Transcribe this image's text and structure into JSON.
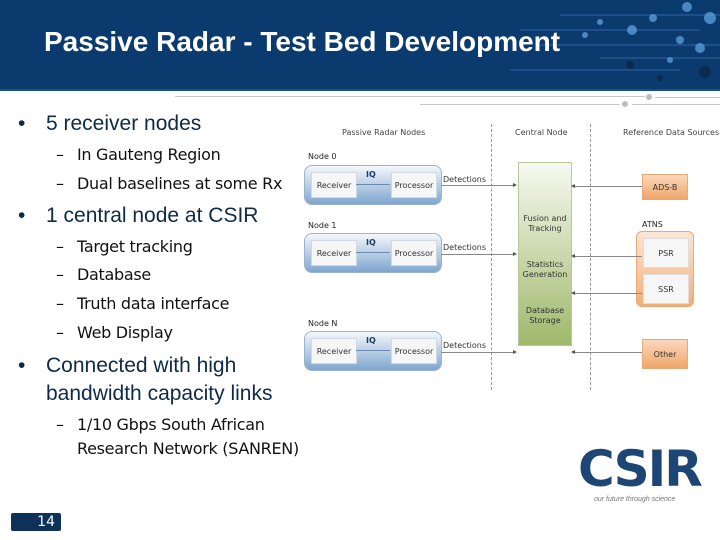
{
  "slide": {
    "title": "Passive Radar - Test Bed Development",
    "page_number": "14",
    "colors": {
      "header": "#0a3a6e",
      "text_dark": "#0e2a47",
      "node_blue": "#7fa6cf",
      "central_green": "#9fb86a",
      "ref_orange": "#f0a66a"
    }
  },
  "bullets": [
    {
      "text": "5 receiver nodes",
      "bullet": "•",
      "sub": [
        {
          "dash": "–",
          "text": "In Gauteng Region"
        },
        {
          "dash": "–",
          "text": "Dual baselines at some Rx"
        }
      ]
    },
    {
      "text": "1 central node at CSIR",
      "bullet": "•",
      "sub": [
        {
          "dash": "–",
          "text": "Target tracking"
        },
        {
          "dash": "–",
          "text": "Database"
        },
        {
          "dash": "–",
          "text": "Truth data interface"
        },
        {
          "dash": "–",
          "text": "Web Display"
        }
      ]
    },
    {
      "text_line1": "Connected with high",
      "text_line2": "bandwidth capacity links",
      "bullet": "•",
      "sub": [
        {
          "dash": "–",
          "text_line1": "1/10 Gbps South African",
          "text_line2": "Research Network (SANREN)"
        }
      ]
    }
  ],
  "diagram": {
    "columns": {
      "nodes": "Passive Radar Nodes",
      "central": "Central Node",
      "reference": "Reference Data Sources"
    },
    "nodes": [
      {
        "label": "Node 0",
        "receiver": "Receiver",
        "iq": "IQ",
        "processor": "Processor",
        "output": "Detections"
      },
      {
        "label": "Node 1",
        "receiver": "Receiver",
        "iq": "IQ",
        "processor": "Processor",
        "output": "Detections"
      },
      {
        "label": "Node N",
        "receiver": "Receiver",
        "iq": "IQ",
        "processor": "Processor",
        "output": "Detections"
      }
    ],
    "central": {
      "fusion": "Fusion and Tracking",
      "fusion_l1": "Fusion and",
      "fusion_l2": "Tracking",
      "stats_l1": "Statistics",
      "stats_l2": "Generation",
      "db_l1": "Database",
      "db_l2": "Storage"
    },
    "reference": {
      "adsb": "ADS-B",
      "atns": "ATNS",
      "psr": "PSR",
      "ssr": "SSR",
      "other": "Other"
    }
  },
  "logo": {
    "text": "CSIR",
    "tagline": "our future through science"
  }
}
